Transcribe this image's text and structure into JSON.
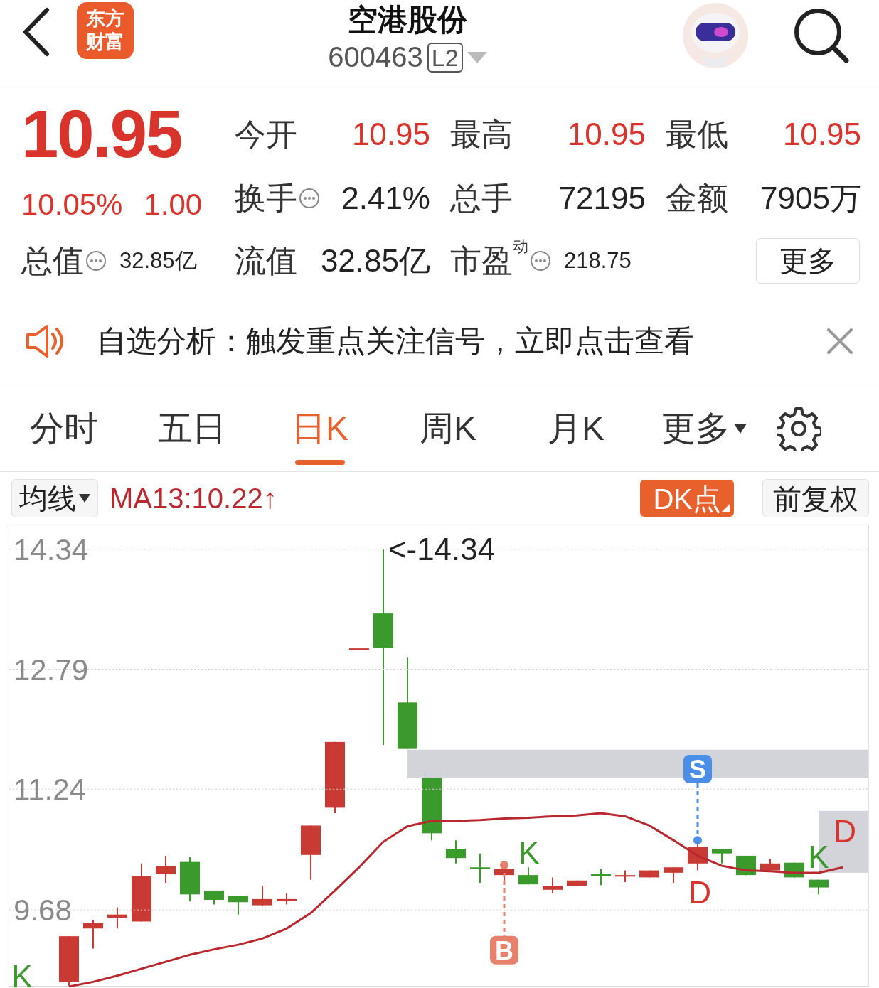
{
  "header": {
    "logo_lines": [
      "东方",
      "财富"
    ],
    "title": "空港股份",
    "code": "600463",
    "badge": "L2"
  },
  "quote": {
    "price": "10.95",
    "change_percent": "10.05%",
    "change": "1.00",
    "stats": [
      {
        "label": "今开",
        "value": "10.95",
        "kind": "up",
        "info": false
      },
      {
        "label": "最高",
        "value": "10.95",
        "kind": "up",
        "info": false
      },
      {
        "label": "最低",
        "value": "10.95",
        "kind": "up",
        "info": false
      },
      {
        "label": "换手",
        "value": "2.41%",
        "kind": "plain",
        "info": true
      },
      {
        "label": "总手",
        "value": "72195",
        "kind": "plain",
        "info": false
      },
      {
        "label": "金额",
        "value": "7905万",
        "kind": "plain",
        "info": false
      },
      {
        "label": "总值",
        "value": "32.85亿",
        "kind": "small",
        "info": true
      },
      {
        "label": "流值",
        "value": "32.85亿",
        "kind": "plain",
        "info": false
      },
      {
        "label": "市盈$^{动}$",
        "value": "218.75",
        "kind": "small",
        "info": true
      }
    ],
    "more_button": "更多"
  },
  "notice": {
    "text": "自选分析：触发重点关注信号，立即点击查看"
  },
  "tabs": [
    {
      "label": "分时",
      "selected": false,
      "dropdown": false
    },
    {
      "label": "五日",
      "selected": false,
      "dropdown": false
    },
    {
      "label": "日K",
      "selected": true,
      "dropdown": false
    },
    {
      "label": "周K",
      "selected": false,
      "dropdown": false
    },
    {
      "label": "月K",
      "selected": false,
      "dropdown": false
    },
    {
      "label": "更多",
      "selected": false,
      "dropdown": true
    }
  ],
  "toolbar": {
    "indicator": "均线",
    "ma_reading": "MA13:10.22↑",
    "dk_button": "DK点",
    "adjust_button": "前复权"
  },
  "chart": {
    "chart_data": {
      "type": "line",
      "ylim": [
        8.68,
        14.65
      ],
      "yticks": [
        14.34,
        12.79,
        11.24,
        9.68
      ],
      "grid": true,
      "series": [
        {
          "color": "#b8282e",
          "values": [
            8.69,
            8.75,
            8.83,
            8.92,
            9.01,
            9.1,
            9.17,
            9.23,
            9.31,
            9.44,
            9.64,
            9.93,
            10.23,
            10.56,
            10.76,
            10.83,
            10.83,
            10.84,
            10.86,
            10.87,
            10.89,
            10.9,
            10.93,
            10.89,
            10.77,
            10.58,
            10.38,
            10.25,
            10.19,
            10.18,
            10.16,
            10.16,
            10.23
          ]
        }
      ],
      "annotations": [
        "<-14.34",
        "K",
        "K",
        "K",
        "D",
        "D"
      ]
    },
    "signal_badges": [
      {
        "text": "S",
        "color": "#4a8ee8"
      },
      {
        "text": "B",
        "color": "#e8806e"
      }
    ]
  }
}
